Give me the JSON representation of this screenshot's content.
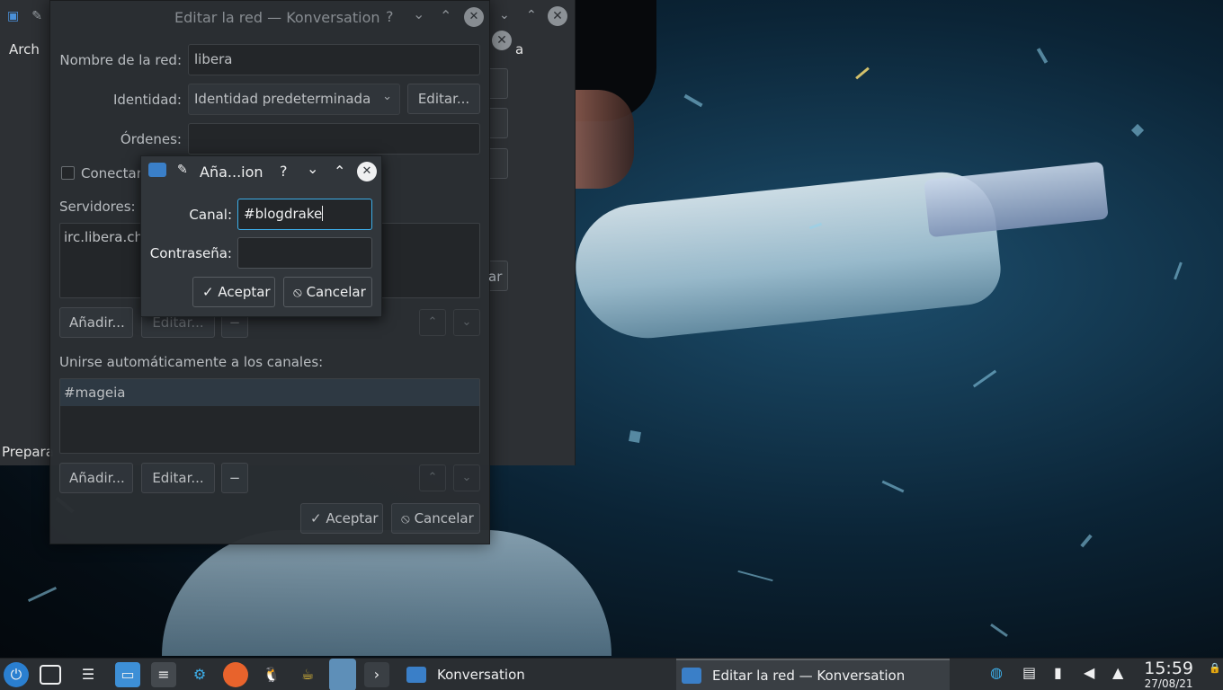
{
  "background_window": {
    "menu_partial": "Arch",
    "status_partial": "Prepara",
    "right_partial": "a"
  },
  "network_dialog": {
    "title": "Editar la red — Konversation",
    "network_name_label": "Nombre de la red:",
    "network_name_value": "libera",
    "identity_label": "Identidad:",
    "identity_value": "Identidad predeterminada",
    "identity_edit_button": "Editar...",
    "commands_label": "Órdenes:",
    "commands_value": "",
    "connect_checkbox_label": "Conectar",
    "servers_label": "Servidores:",
    "servers": [
      "irc.libera.ch"
    ],
    "servers_add_button": "Añadir...",
    "servers_edit_button": "Editar...",
    "servers_remove_button": "−",
    "autojoin_label": "Unirse automáticamente a los canales:",
    "channels": [
      "#mageia"
    ],
    "channels_add_button": "Añadir...",
    "channels_edit_button": "Editar...",
    "channels_remove_button": "−",
    "ok_button": "Aceptar",
    "cancel_button": "Cancelar",
    "partial_button": "ar"
  },
  "channel_dialog": {
    "title": "Aña...ion",
    "channel_label": "Canal:",
    "channel_value": "#blogdrake",
    "password_label": "Contraseña:",
    "password_value": "",
    "ok_button": "Aceptar",
    "cancel_button": "Cancelar"
  },
  "taskbar": {
    "tasks": [
      "Konversation",
      "Editar la red — Konversation"
    ],
    "time": "15:59",
    "date": "27/08/21"
  },
  "icons": {
    "help": "?",
    "minimize": "⌄",
    "maximize": "⌃",
    "close": "✕",
    "check": "✓",
    "cancel": "⦸",
    "pin": "📌"
  }
}
